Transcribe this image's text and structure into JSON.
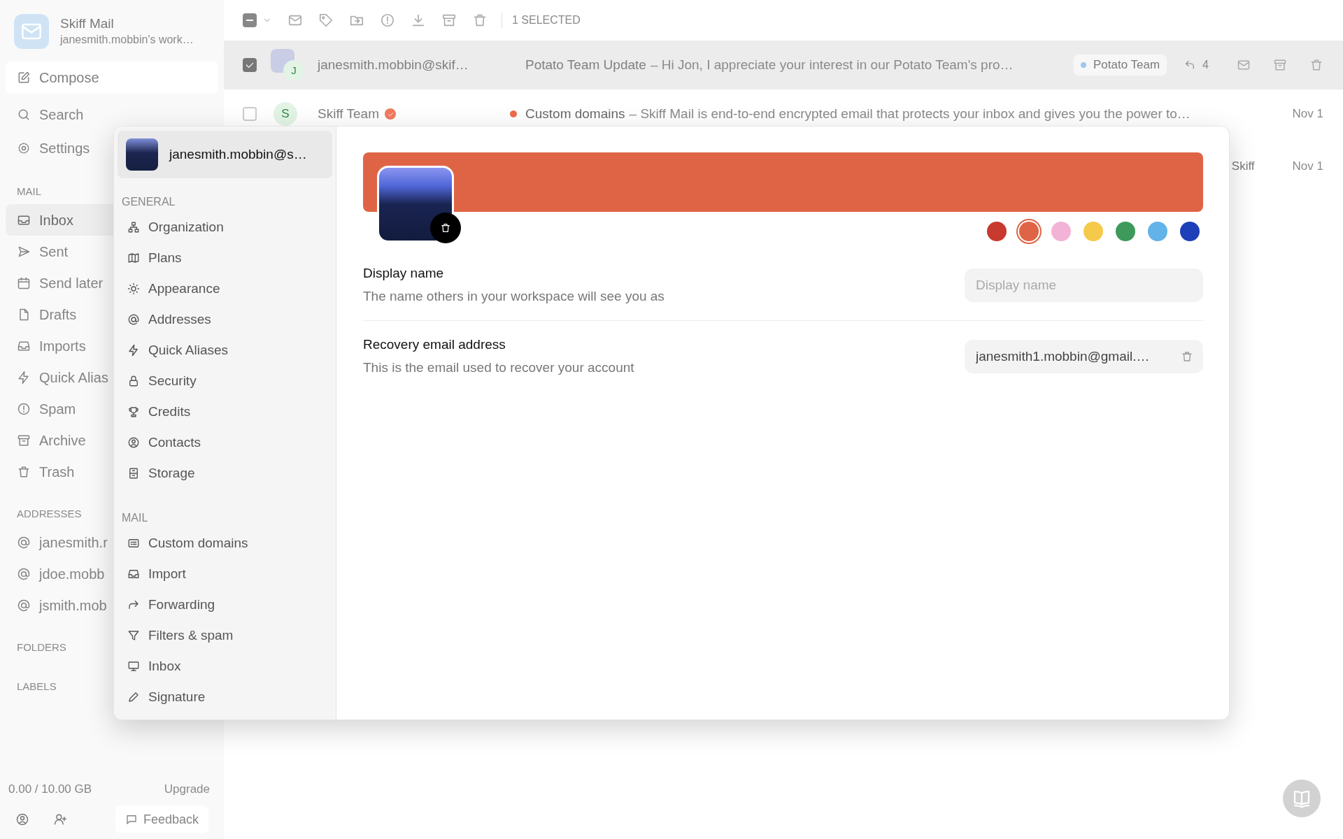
{
  "sidebar": {
    "app_name": "Skiff Mail",
    "workspace": "janesmith.mobbin's work…",
    "compose": "Compose",
    "top_items": [
      {
        "label": "Search"
      },
      {
        "label": "Settings"
      }
    ],
    "sections": [
      {
        "title": "MAIL",
        "items": [
          {
            "label": "Inbox",
            "selected": true
          },
          {
            "label": "Sent",
            "selected": false
          },
          {
            "label": "Send later",
            "selected": false
          },
          {
            "label": "Drafts",
            "selected": false
          },
          {
            "label": "Imports",
            "selected": false
          },
          {
            "label": "Quick Alias",
            "selected": false
          },
          {
            "label": "Spam",
            "selected": false
          },
          {
            "label": "Archive",
            "selected": false
          },
          {
            "label": "Trash",
            "selected": false
          }
        ]
      },
      {
        "title": "ADDRESSES",
        "items": [
          {
            "label": "janesmith.r",
            "selected": false
          },
          {
            "label": "jdoe.mobb",
            "selected": false
          },
          {
            "label": "jsmith.mob",
            "selected": false
          }
        ]
      },
      {
        "title": "FOLDERS"
      },
      {
        "title": "LABELS"
      }
    ],
    "storage": "0.00 / 10.00 GB",
    "upgrade": "Upgrade",
    "feedback": "Feedback"
  },
  "toolbar": {
    "indeterminate": true,
    "selection_count": "1 SELECTED"
  },
  "messages": [
    {
      "checked": true,
      "selected": true,
      "hovered": true,
      "has_photo": true,
      "avatar_letter": "J",
      "sender": "janesmith.mobbin@skif…",
      "verified": false,
      "unread": false,
      "subject": "Potato Team Update",
      "preview": "– Hi Jon, I appreciate your interest in our Potato Team's pro…",
      "label": {
        "text": "Potato Team",
        "color": "#9cc6ee"
      },
      "thread_count": "4"
    },
    {
      "checked": false,
      "selected": false,
      "hovered": false,
      "has_photo": false,
      "avatar_letter": "S",
      "sender": "Skiff Team",
      "verified": true,
      "unread": true,
      "subject": "Custom domains",
      "preview": "– Skiff Mail is end-to-end encrypted email that protects your inbox and gives you the power to…",
      "date": "Nov 1"
    },
    {
      "selected": false,
      "hovered": false,
      "label": {
        "text": "Skiff"
      },
      "date": "Nov 1"
    }
  ],
  "settings": {
    "account": {
      "email": "janesmith.mobbin@s…",
      "selected": true
    },
    "nav_sections": [
      {
        "title": "GENERAL",
        "items": [
          {
            "label": "Organization",
            "selected": false
          },
          {
            "label": "Plans",
            "selected": false
          },
          {
            "label": "Appearance",
            "selected": false
          },
          {
            "label": "Addresses",
            "selected": false
          },
          {
            "label": "Quick Aliases",
            "selected": false
          },
          {
            "label": "Security",
            "selected": false
          },
          {
            "label": "Credits",
            "selected": false
          },
          {
            "label": "Contacts",
            "selected": false
          },
          {
            "label": "Storage",
            "selected": false
          }
        ]
      },
      {
        "title": "MAIL",
        "items": [
          {
            "label": "Custom domains",
            "selected": false
          },
          {
            "label": "Import",
            "selected": false
          },
          {
            "label": "Forwarding",
            "selected": false
          },
          {
            "label": "Filters & spam",
            "selected": false
          },
          {
            "label": "Inbox",
            "selected": false
          },
          {
            "label": "Signature",
            "selected": false
          }
        ]
      }
    ],
    "profile": {
      "colors": [
        {
          "color": "#c8392e",
          "selected": false
        },
        {
          "color": "#df6446",
          "selected": true
        },
        {
          "color": "#f2b3d6",
          "selected": false
        },
        {
          "color": "#f5c94a",
          "selected": false
        },
        {
          "color": "#3d9a5b",
          "selected": false
        },
        {
          "color": "#62b3e8",
          "selected": false
        },
        {
          "color": "#1d3fb8",
          "selected": false
        }
      ],
      "display_name": {
        "label": "Display name",
        "description": "The name others in your workspace will see you as",
        "placeholder": "Display name"
      },
      "recovery_email": {
        "label": "Recovery email address",
        "description": "This is the email used to recover your account",
        "value": "janesmith1.mobbin@gmail.…"
      }
    }
  }
}
